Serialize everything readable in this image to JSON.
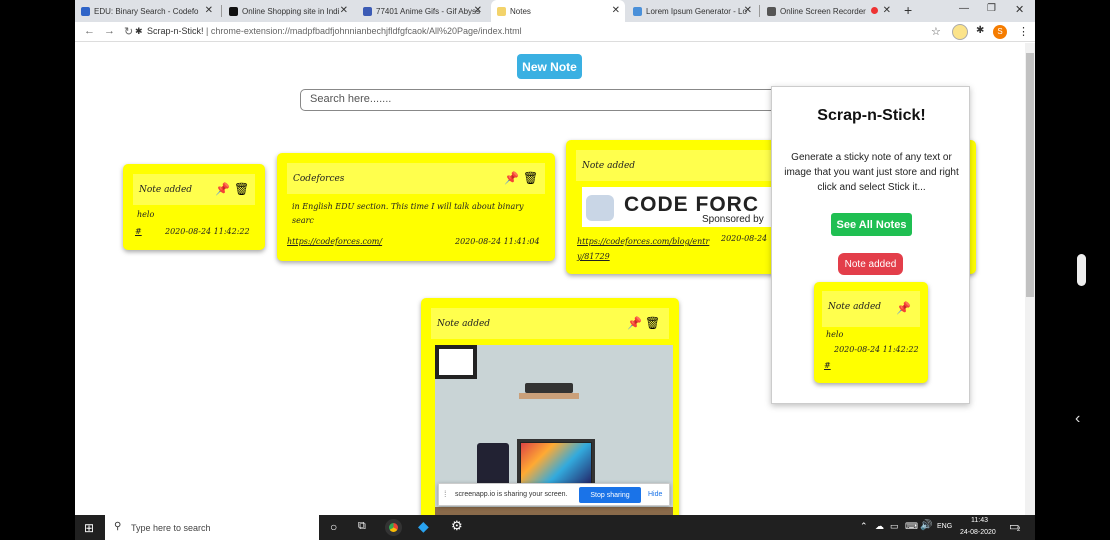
{
  "tabs": [
    {
      "label": "EDU: Binary Search - Codefo",
      "color": "#2f64c8"
    },
    {
      "label": "Online Shopping site in Indi",
      "color": "#111"
    },
    {
      "label": "77401 Anime Gifs - Gif Abyss",
      "color": "#3c5bb5"
    },
    {
      "label": "Notes",
      "color": "#f3d36b"
    },
    {
      "label": "Lorem Ipsum Generator - Lo",
      "color": "#4a90d9"
    },
    {
      "label": "Online Screen Recorder",
      "color": "#555"
    }
  ],
  "address": {
    "title": "Scrap-n-Stick!",
    "sep": "|",
    "url": "chrome-extension://madpfbadfjohnnianbechjfldfgfcaok/All%20Page/index.html"
  },
  "toolbar": {
    "new_note": "New Note",
    "search_placeholder": "Search here......."
  },
  "notes": [
    {
      "title": "Note added",
      "body": "helo",
      "link": "#",
      "date": "2020-08-24 11:42:22"
    },
    {
      "title": "Codeforces",
      "body": "in English EDU section. This time I will talk about binary searc",
      "link": "https://codeforces.com/",
      "date": "2020-08-24 11:41:04"
    },
    {
      "title": "Note added",
      "image_text": "CODE FORC",
      "image_sub": "Sponsored by",
      "link": "https://codeforces.com/blog/entry/81729",
      "date": "2020-08-24"
    },
    {
      "title": "Note added"
    }
  ],
  "popup": {
    "title": "Scrap-n-Stick!",
    "description": "Generate a sticky note of any text or image that you want just store and right click and select Stick it...",
    "see_all": "See All Notes",
    "note_added": "Note added",
    "mini_note": {
      "title": "Note added",
      "body": "helo",
      "date": "2020-08-24 11:42:22",
      "link": "#"
    }
  },
  "share_bar": {
    "text": "screenapp.io is sharing your screen.",
    "stop": "Stop sharing",
    "hide": "Hide"
  },
  "taskbar": {
    "search": "Type here to search",
    "time": "11:43",
    "date": "24-08-2020",
    "lang": "ENG",
    "notif": "2"
  },
  "colors": {
    "note": "#ffff00",
    "note_header": "#ffff4d",
    "accent_blue": "#3ab0e2",
    "green": "#1fbf52",
    "red": "#e33e4a"
  }
}
